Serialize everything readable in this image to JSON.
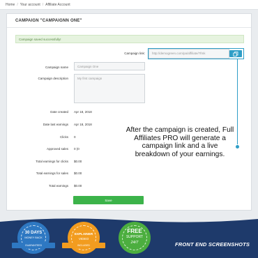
{
  "breadcrumb": {
    "items": [
      "Home",
      "Your account",
      "Affiliate Account"
    ],
    "separator": "/"
  },
  "panel": {
    "title": "CAMPAIGN \"CAMPAIGNN ONE\"",
    "alert": "Campaign saved successfully!"
  },
  "form": {
    "campaign_link": {
      "label": "Campaign link:",
      "value": "http://demogreen.com/pa/affiliate/?fmk"
    },
    "campaign_name": {
      "label": "Campaign name",
      "value": "Campaign One"
    },
    "campaign_description": {
      "label": "Campaign description",
      "value": "My first campaign"
    },
    "date_created": {
      "label": "Date created",
      "value": "Apr 18, 2018"
    },
    "date_last_earnings": {
      "label": "Date last earnings",
      "value": "Apr 18, 2018"
    },
    "clicks": {
      "label": "Clicks",
      "value": "0"
    },
    "approved_sales": {
      "label": "Approved sales",
      "value": "0 (0"
    },
    "total_earnings_clicks": {
      "label": "Total earnings for clicks",
      "value": "$0.00"
    },
    "total_earnings_sales": {
      "label": "Total earnings for sales",
      "value": "$0.00"
    },
    "total_earnings": {
      "label": "Total earnings",
      "value": "$0.00"
    },
    "save_label": "Save"
  },
  "callout": {
    "text": "After the campaign is created, Full Affiliates PRO will generate a campaign link and a live breakdown of your earnings."
  },
  "badges": [
    {
      "title": "30 DAYS",
      "subtitle": "MONEY BACK",
      "ribbon": "GUARANTEED",
      "color": "#2e78c2"
    },
    {
      "title": "EXPLAINER",
      "subtitle": "VIDEO",
      "ribbon": "INCLUDED",
      "color": "#f29c1f"
    },
    {
      "title": "FREE",
      "subtitle": "SUPPORT",
      "ribbon": "24/7",
      "color": "#4cae3f"
    }
  ],
  "footer": {
    "label": "FRONT END SCREENSHOTS"
  },
  "colors": {
    "accent": "#2f9ec7",
    "success": "#3cb34a",
    "footer_bg": "#1e3a6b"
  },
  "icons": {
    "copy": "copy-icon"
  }
}
